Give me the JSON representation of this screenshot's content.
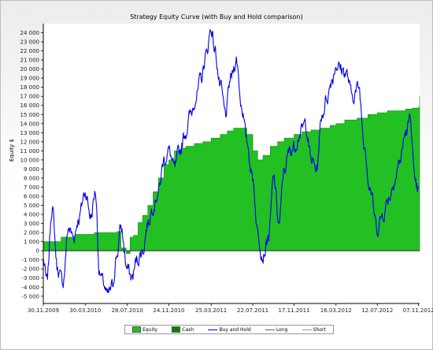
{
  "chart_data": {
    "type": "area",
    "title": "Strategy Equity Curve (with Buy and Hold comparison)",
    "ylabel": "Equity $",
    "xlabel": "",
    "ylim": [
      -5800,
      25000
    ],
    "xlim": [
      "2009-11-30",
      "2012-11-10"
    ],
    "y_ticks": [
      "-5 000",
      "-4 000",
      "-3 000",
      "-2 000",
      "-1 000",
      "0",
      "1 000",
      "2 000",
      "3 000",
      "4 000",
      "5 000",
      "6 000",
      "7 000",
      "8 000",
      "9 000",
      "10 000",
      "11 000",
      "12 000",
      "13 000",
      "14 000",
      "15 000",
      "16 000",
      "17 000",
      "18 000",
      "19 000",
      "20 000",
      "21 000",
      "22 000",
      "23 000",
      "24 000"
    ],
    "x_ticks": [
      "30.11.2009",
      "30.03.2010",
      "28.07.2010",
      "24.11.2010",
      "25.03.2011",
      "22.07.2011",
      "17.11.2011",
      "16.03.2012",
      "12.07.2012",
      "07.11.2012"
    ],
    "grid": false,
    "legend_position": "bottom",
    "colors": {
      "equity": "#22c022",
      "cash": "#008800",
      "buy_and_hold": "#0000ee",
      "long": "#6a6a2a",
      "short": "#b88a64"
    },
    "legend": [
      {
        "label": "Equity",
        "kind": "box",
        "color": "#22c022"
      },
      {
        "label": "Cash",
        "kind": "box",
        "color": "#008800"
      },
      {
        "label": "Buy and Hold",
        "kind": "line",
        "color": "#0000ee"
      },
      {
        "label": "Long",
        "kind": "line",
        "color": "#6a6a2a"
      },
      {
        "label": "Short",
        "kind": "line",
        "color": "#b88a64"
      }
    ],
    "series": [
      {
        "name": "Equity",
        "x": [
          "2009-11-30",
          "2010-01-10",
          "2010-01-20",
          "2010-02-15",
          "2010-03-01",
          "2010-03-25",
          "2010-04-25",
          "2010-05-25",
          "2010-06-18",
          "2010-06-28",
          "2010-07-10",
          "2010-07-25",
          "2010-08-05",
          "2010-08-15",
          "2010-08-28",
          "2010-09-10",
          "2010-09-25",
          "2010-10-10",
          "2010-10-25",
          "2010-11-10",
          "2010-11-24",
          "2010-12-10",
          "2010-12-28",
          "2011-01-12",
          "2011-02-05",
          "2011-03-01",
          "2011-03-25",
          "2011-04-20",
          "2011-05-10",
          "2011-05-28",
          "2011-06-20",
          "2011-07-05",
          "2011-07-22",
          "2011-08-05",
          "2011-08-20",
          "2011-09-10",
          "2011-10-01",
          "2011-10-20",
          "2011-11-17",
          "2011-12-10",
          "2012-01-05",
          "2012-02-01",
          "2012-02-28",
          "2012-03-16",
          "2012-04-10",
          "2012-05-15",
          "2012-06-15",
          "2012-07-12",
          "2012-08-10",
          "2012-09-05",
          "2012-10-01",
          "2012-10-20",
          "2012-11-07",
          "2012-11-10"
        ],
        "y": [
          1000,
          1000,
          1500,
          1500,
          1800,
          1800,
          2000,
          2000,
          2000,
          2100,
          300,
          -300,
          1500,
          1700,
          3100,
          3900,
          5000,
          6500,
          8000,
          9500,
          10000,
          11000,
          11300,
          11500,
          11800,
          12000,
          12400,
          12800,
          13200,
          13500,
          13500,
          12800,
          11000,
          10000,
          10500,
          11500,
          12000,
          12400,
          12800,
          13100,
          13300,
          13500,
          13800,
          14000,
          14400,
          14600,
          15000,
          15200,
          15400,
          15400,
          15600,
          15700,
          15800,
          17000
        ]
      },
      {
        "name": "Buy and Hold",
        "x": [
          "2009-11-30",
          "2009-12-10",
          "2009-12-25",
          "2010-01-10",
          "2010-01-25",
          "2010-02-10",
          "2010-02-25",
          "2010-03-10",
          "2010-03-30",
          "2010-04-15",
          "2010-04-28",
          "2010-05-10",
          "2010-05-20",
          "2010-06-01",
          "2010-06-15",
          "2010-06-28",
          "2010-07-10",
          "2010-07-28",
          "2010-08-10",
          "2010-08-25",
          "2010-09-10",
          "2010-09-25",
          "2010-10-10",
          "2010-10-25",
          "2010-11-10",
          "2010-11-24",
          "2010-12-10",
          "2010-12-25",
          "2011-01-10",
          "2011-01-25",
          "2011-02-10",
          "2011-02-25",
          "2011-03-10",
          "2011-03-25",
          "2011-04-05",
          "2011-04-20",
          "2011-05-05",
          "2011-05-20",
          "2011-06-05",
          "2011-06-20",
          "2011-07-05",
          "2011-07-22",
          "2011-08-05",
          "2011-08-20",
          "2011-09-05",
          "2011-09-20",
          "2011-10-05",
          "2011-10-20",
          "2011-11-05",
          "2011-11-17",
          "2011-12-05",
          "2011-12-20",
          "2012-01-05",
          "2012-01-20",
          "2012-02-05",
          "2012-02-20",
          "2012-03-05",
          "2012-03-16",
          "2012-04-01",
          "2012-04-15",
          "2012-05-01",
          "2012-05-20",
          "2012-06-05",
          "2012-06-20",
          "2012-07-12",
          "2012-07-28",
          "2012-08-15",
          "2012-09-01",
          "2012-09-15",
          "2012-10-01",
          "2012-10-15",
          "2012-10-28",
          "2012-11-07"
        ],
        "y": [
          -1000,
          -3500,
          4800,
          -2000,
          -3500,
          2500,
          1500,
          3500,
          6500,
          3800,
          6500,
          -2500,
          -3500,
          -5000,
          -4000,
          -500,
          2500,
          -2000,
          -3000,
          -1000,
          0,
          3000,
          5000,
          6500,
          10000,
          11000,
          9000,
          11000,
          13000,
          15000,
          17000,
          19000,
          21500,
          24500,
          22000,
          18000,
          15000,
          19000,
          21000,
          16000,
          12000,
          8000,
          2000,
          -500,
          1500,
          8000,
          3000,
          9000,
          11000,
          11500,
          13000,
          14000,
          10000,
          9000,
          15000,
          17000,
          19000,
          20500,
          20000,
          19500,
          17000,
          18000,
          12000,
          7000,
          2500,
          4000,
          6000,
          8000,
          10000,
          13000,
          14500,
          7000,
          6500
        ]
      }
    ]
  }
}
